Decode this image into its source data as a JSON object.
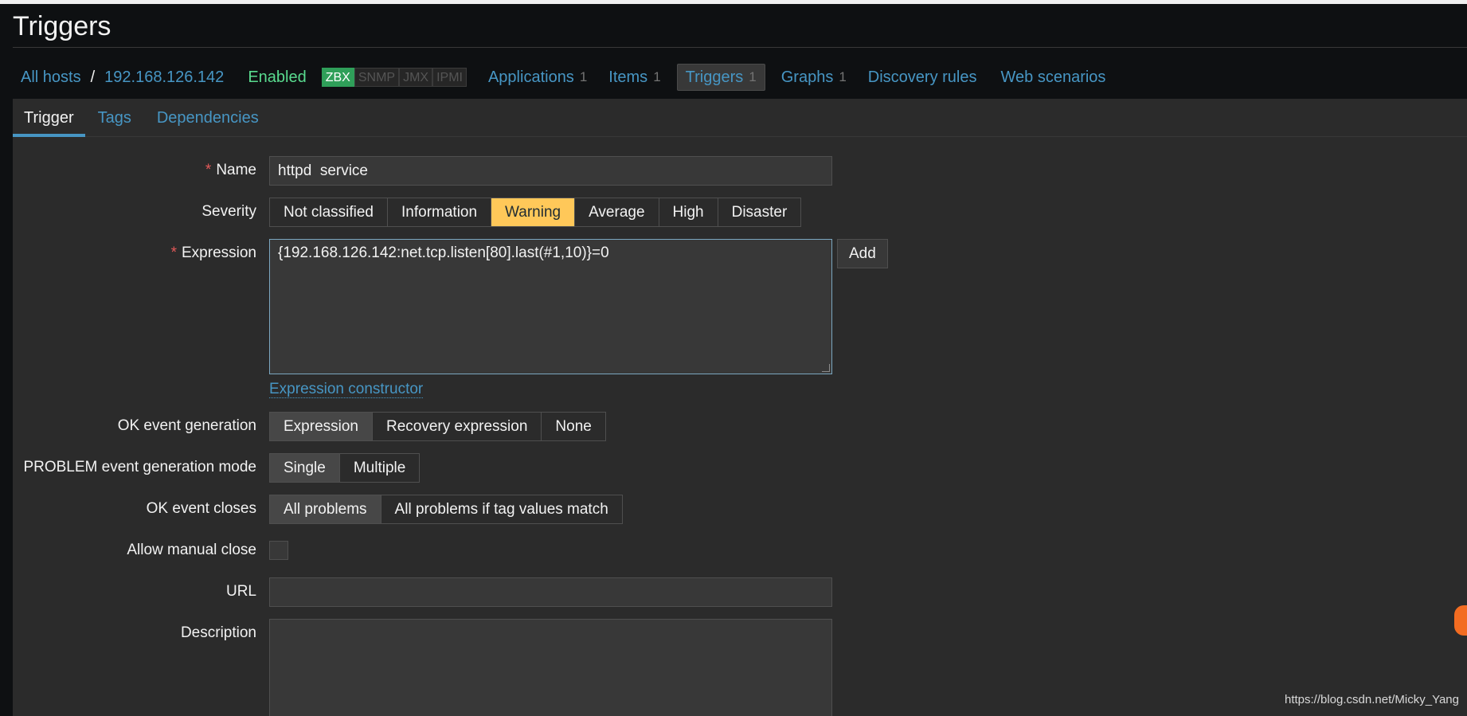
{
  "page": {
    "title": "Triggers"
  },
  "hostnav": {
    "all_hosts": "All hosts",
    "separator": "/",
    "host": "192.168.126.142",
    "status": "Enabled",
    "availability": [
      "ZBX",
      "SNMP",
      "JMX",
      "IPMI"
    ],
    "items": [
      {
        "label": "Applications",
        "count": "1"
      },
      {
        "label": "Items",
        "count": "1"
      },
      {
        "label": "Triggers",
        "count": "1"
      },
      {
        "label": "Graphs",
        "count": "1"
      },
      {
        "label": "Discovery rules",
        "count": ""
      },
      {
        "label": "Web scenarios",
        "count": ""
      }
    ]
  },
  "tabs": [
    "Trigger",
    "Tags",
    "Dependencies"
  ],
  "form": {
    "name": {
      "label": "Name",
      "required": "*",
      "value": "httpd  service"
    },
    "severity": {
      "label": "Severity",
      "options": [
        "Not classified",
        "Information",
        "Warning",
        "Average",
        "High",
        "Disaster"
      ],
      "selected": "Warning"
    },
    "expression": {
      "label": "Expression",
      "required": "*",
      "value": "{192.168.126.142:net.tcp.listen[80].last(#1,10)}=0",
      "add_label": "Add",
      "constructor_link": "Expression constructor"
    },
    "ok_event_generation": {
      "label": "OK event generation",
      "options": [
        "Expression",
        "Recovery expression",
        "None"
      ],
      "selected": "Expression"
    },
    "problem_mode": {
      "label": "PROBLEM event generation mode",
      "options": [
        "Single",
        "Multiple"
      ],
      "selected": "Single"
    },
    "ok_event_closes": {
      "label": "OK event closes",
      "options": [
        "All problems",
        "All problems if tag values match"
      ],
      "selected": "All problems"
    },
    "manual_close": {
      "label": "Allow manual close",
      "checked": false
    },
    "url": {
      "label": "URL",
      "value": ""
    },
    "description": {
      "label": "Description",
      "value": ""
    }
  },
  "watermark": "https://blog.csdn.net/Micky_Yang",
  "colors": {
    "background": "#0e1012",
    "panel": "#2b2b2b",
    "link": "#4796c4",
    "enabled": "#59db8f",
    "zbx": "#2f9f59",
    "warning": "#ffc859",
    "required": "#e45959"
  }
}
